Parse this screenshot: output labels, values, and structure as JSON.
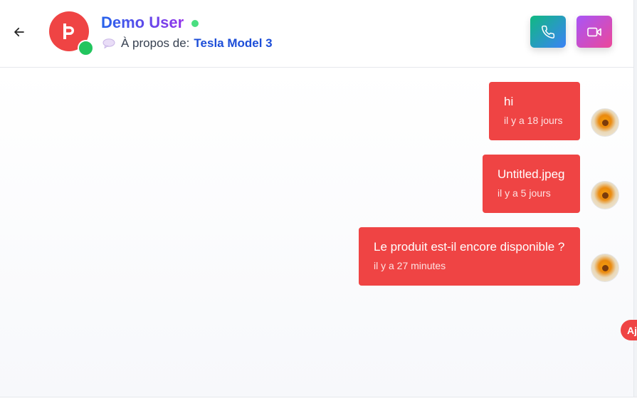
{
  "header": {
    "user_name": "Demo User",
    "about_label": "À propos de:",
    "product_name": "Tesla Model 3",
    "avatar_letter": "þ"
  },
  "messages": [
    {
      "text": "hi",
      "time": "il y a 18 jours"
    },
    {
      "text": "Untitled.jpeg",
      "time": "il y a 5 jours"
    },
    {
      "text": "Le produit est-il encore disponible ?",
      "time": "il y a 27 minutes"
    }
  ],
  "floating": {
    "pill_label": "Aj"
  },
  "colors": {
    "accent": "#ef4444",
    "online": "#22c55e",
    "name_gradient_start": "#2563eb",
    "name_gradient_end": "#9333ea",
    "call_gradient": [
      "#10b981",
      "#3b82f6"
    ],
    "video_gradient": [
      "#a855f7",
      "#ec4899"
    ]
  },
  "icons": {
    "back": "arrow-left-icon",
    "call": "phone-icon",
    "video": "video-camera-icon",
    "about": "speech-bubble-icon"
  }
}
